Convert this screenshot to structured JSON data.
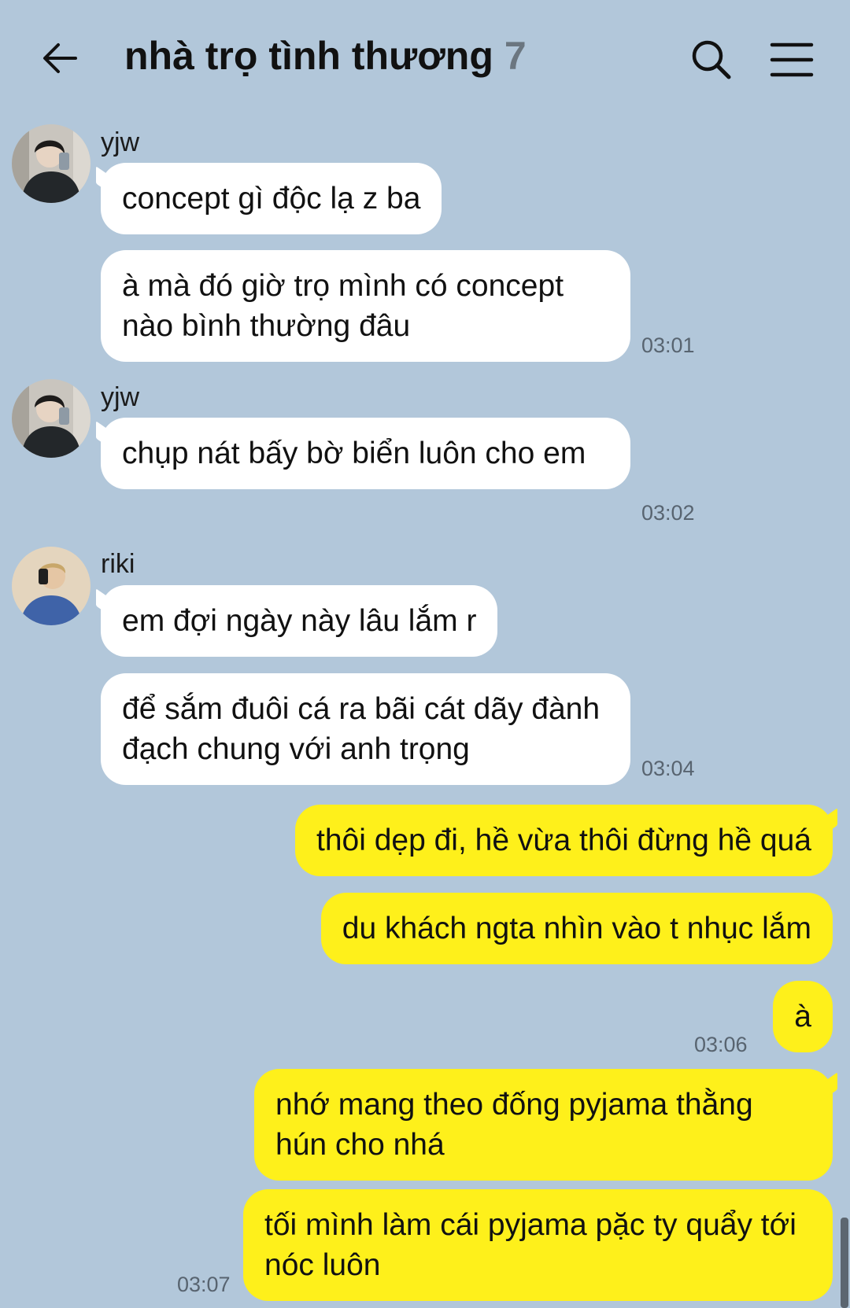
{
  "header": {
    "title": "nhà trọ tình thương",
    "member_count": "7",
    "back_icon": "arrow-left-icon",
    "search_icon": "search-icon",
    "menu_icon": "hamburger-menu-icon"
  },
  "colors": {
    "background": "#b2c7da",
    "incoming_bubble": "#ffffff",
    "outgoing_bubble": "#fef01b"
  },
  "messages": {
    "g1": {
      "sender": "yjw",
      "m1": "concept gì độc lạ z ba",
      "m2": "à mà đó giờ trọ mình có concept nào bình thường đâu",
      "time": "03:01"
    },
    "g2": {
      "sender": "yjw",
      "m1": "chụp nát bấy bờ biển luôn cho em",
      "time": "03:02"
    },
    "g3": {
      "sender": "riki",
      "m1": "em đợi ngày này lâu lắm r",
      "m2": "để sắm đuôi cá ra bãi cát dãy đành đạch chung với anh trọng",
      "time": "03:04"
    },
    "me1": {
      "m1": "thôi dẹp đi, hề vừa thôi đừng hề quá",
      "m2": "du khách ngta nhìn vào t nhục lắm",
      "m3": "à",
      "time": "03:06"
    },
    "me2": {
      "m1": "nhớ mang theo đống pyjama thằng hún cho nhá",
      "m2": "tối mình làm cái pyjama pặc ty quẩy tới nóc luôn",
      "time": "03:07"
    }
  }
}
